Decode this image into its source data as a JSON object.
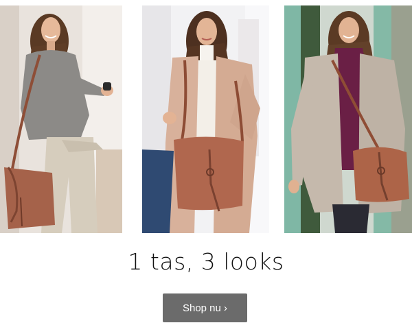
{
  "promo": {
    "headline": "1 tas, 3 looks",
    "cta_label": "Shop nu ›",
    "cta_color": "#6b6b6b"
  },
  "photos": [
    {
      "name": "look-casual-grey-sweater",
      "bag_color": "#a5624a"
    },
    {
      "name": "look-camel-coat",
      "bag_color": "#b0674e"
    },
    {
      "name": "look-parka-purple-hoodie",
      "bag_color": "#ad6448"
    }
  ]
}
